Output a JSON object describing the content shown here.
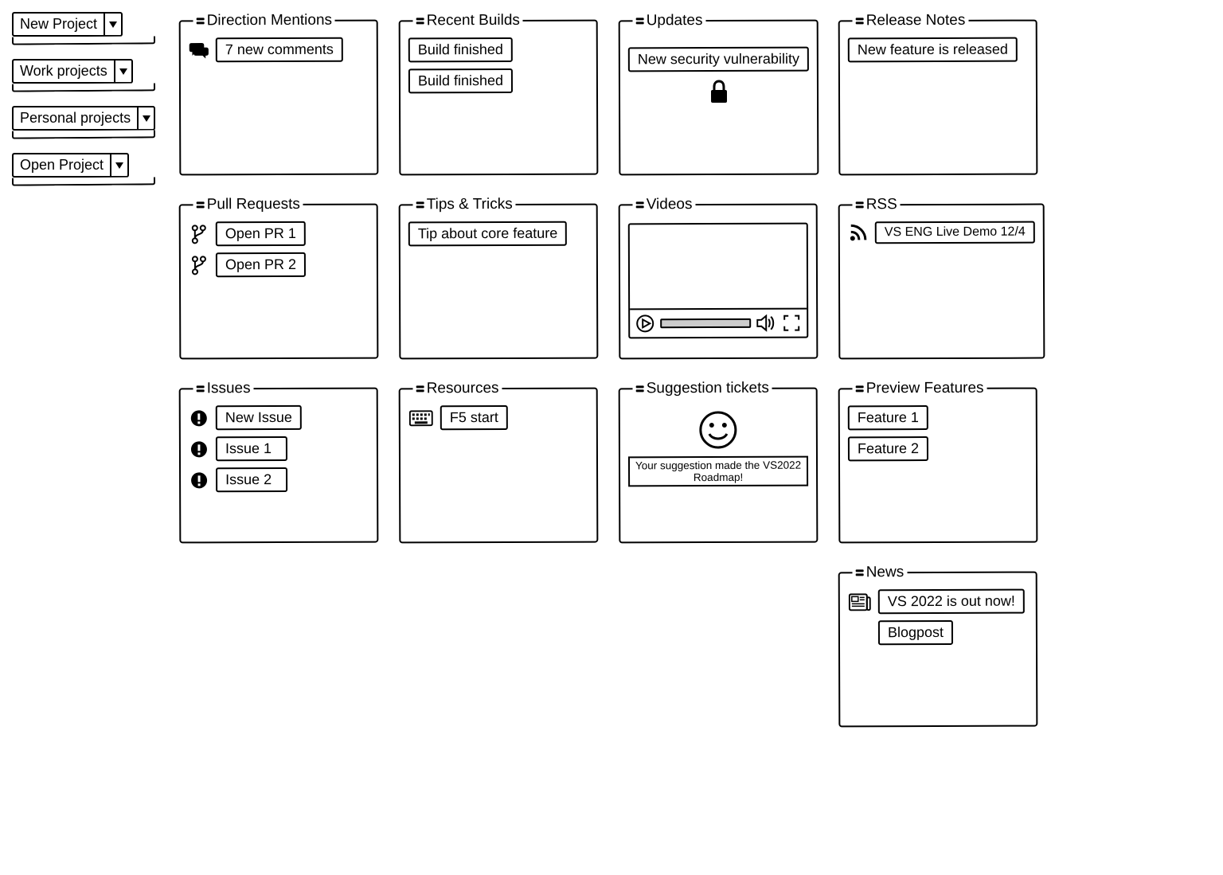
{
  "sidebar": {
    "items": [
      {
        "label": "New Project"
      },
      {
        "label": "Work projects"
      },
      {
        "label": "Personal projects"
      },
      {
        "label": "Open Project"
      }
    ]
  },
  "cards": {
    "direction_mentions": {
      "title": "Direction Mentions",
      "items": [
        "7 new comments"
      ]
    },
    "recent_builds": {
      "title": "Recent Builds",
      "items": [
        "Build finished",
        "Build finished"
      ]
    },
    "updates": {
      "title": "Updates",
      "items": [
        "New security vulnerability"
      ]
    },
    "release_notes": {
      "title": "Release Notes",
      "items": [
        "New feature is released"
      ]
    },
    "pull_requests": {
      "title": "Pull Requests",
      "items": [
        "Open PR 1",
        "Open PR 2"
      ]
    },
    "tips_tricks": {
      "title": "Tips & Tricks",
      "items": [
        "Tip about core feature"
      ]
    },
    "videos": {
      "title": "Videos"
    },
    "rss": {
      "title": "RSS",
      "items": [
        "VS ENG Live Demo 12/4"
      ]
    },
    "issues": {
      "title": "Issues",
      "items": [
        "New Issue",
        "Issue 1",
        "Issue 2"
      ]
    },
    "resources": {
      "title": "Resources",
      "items": [
        "F5 start"
      ]
    },
    "suggestion_tickets": {
      "title": "Suggestion tickets",
      "banner": "Your suggestion made the VS2022 Roadmap!"
    },
    "preview_features": {
      "title": "Preview Features",
      "items": [
        "Feature 1",
        "Feature 2"
      ]
    },
    "news": {
      "title": "News",
      "items": [
        "VS 2022 is out now!",
        "Blogpost"
      ]
    }
  }
}
